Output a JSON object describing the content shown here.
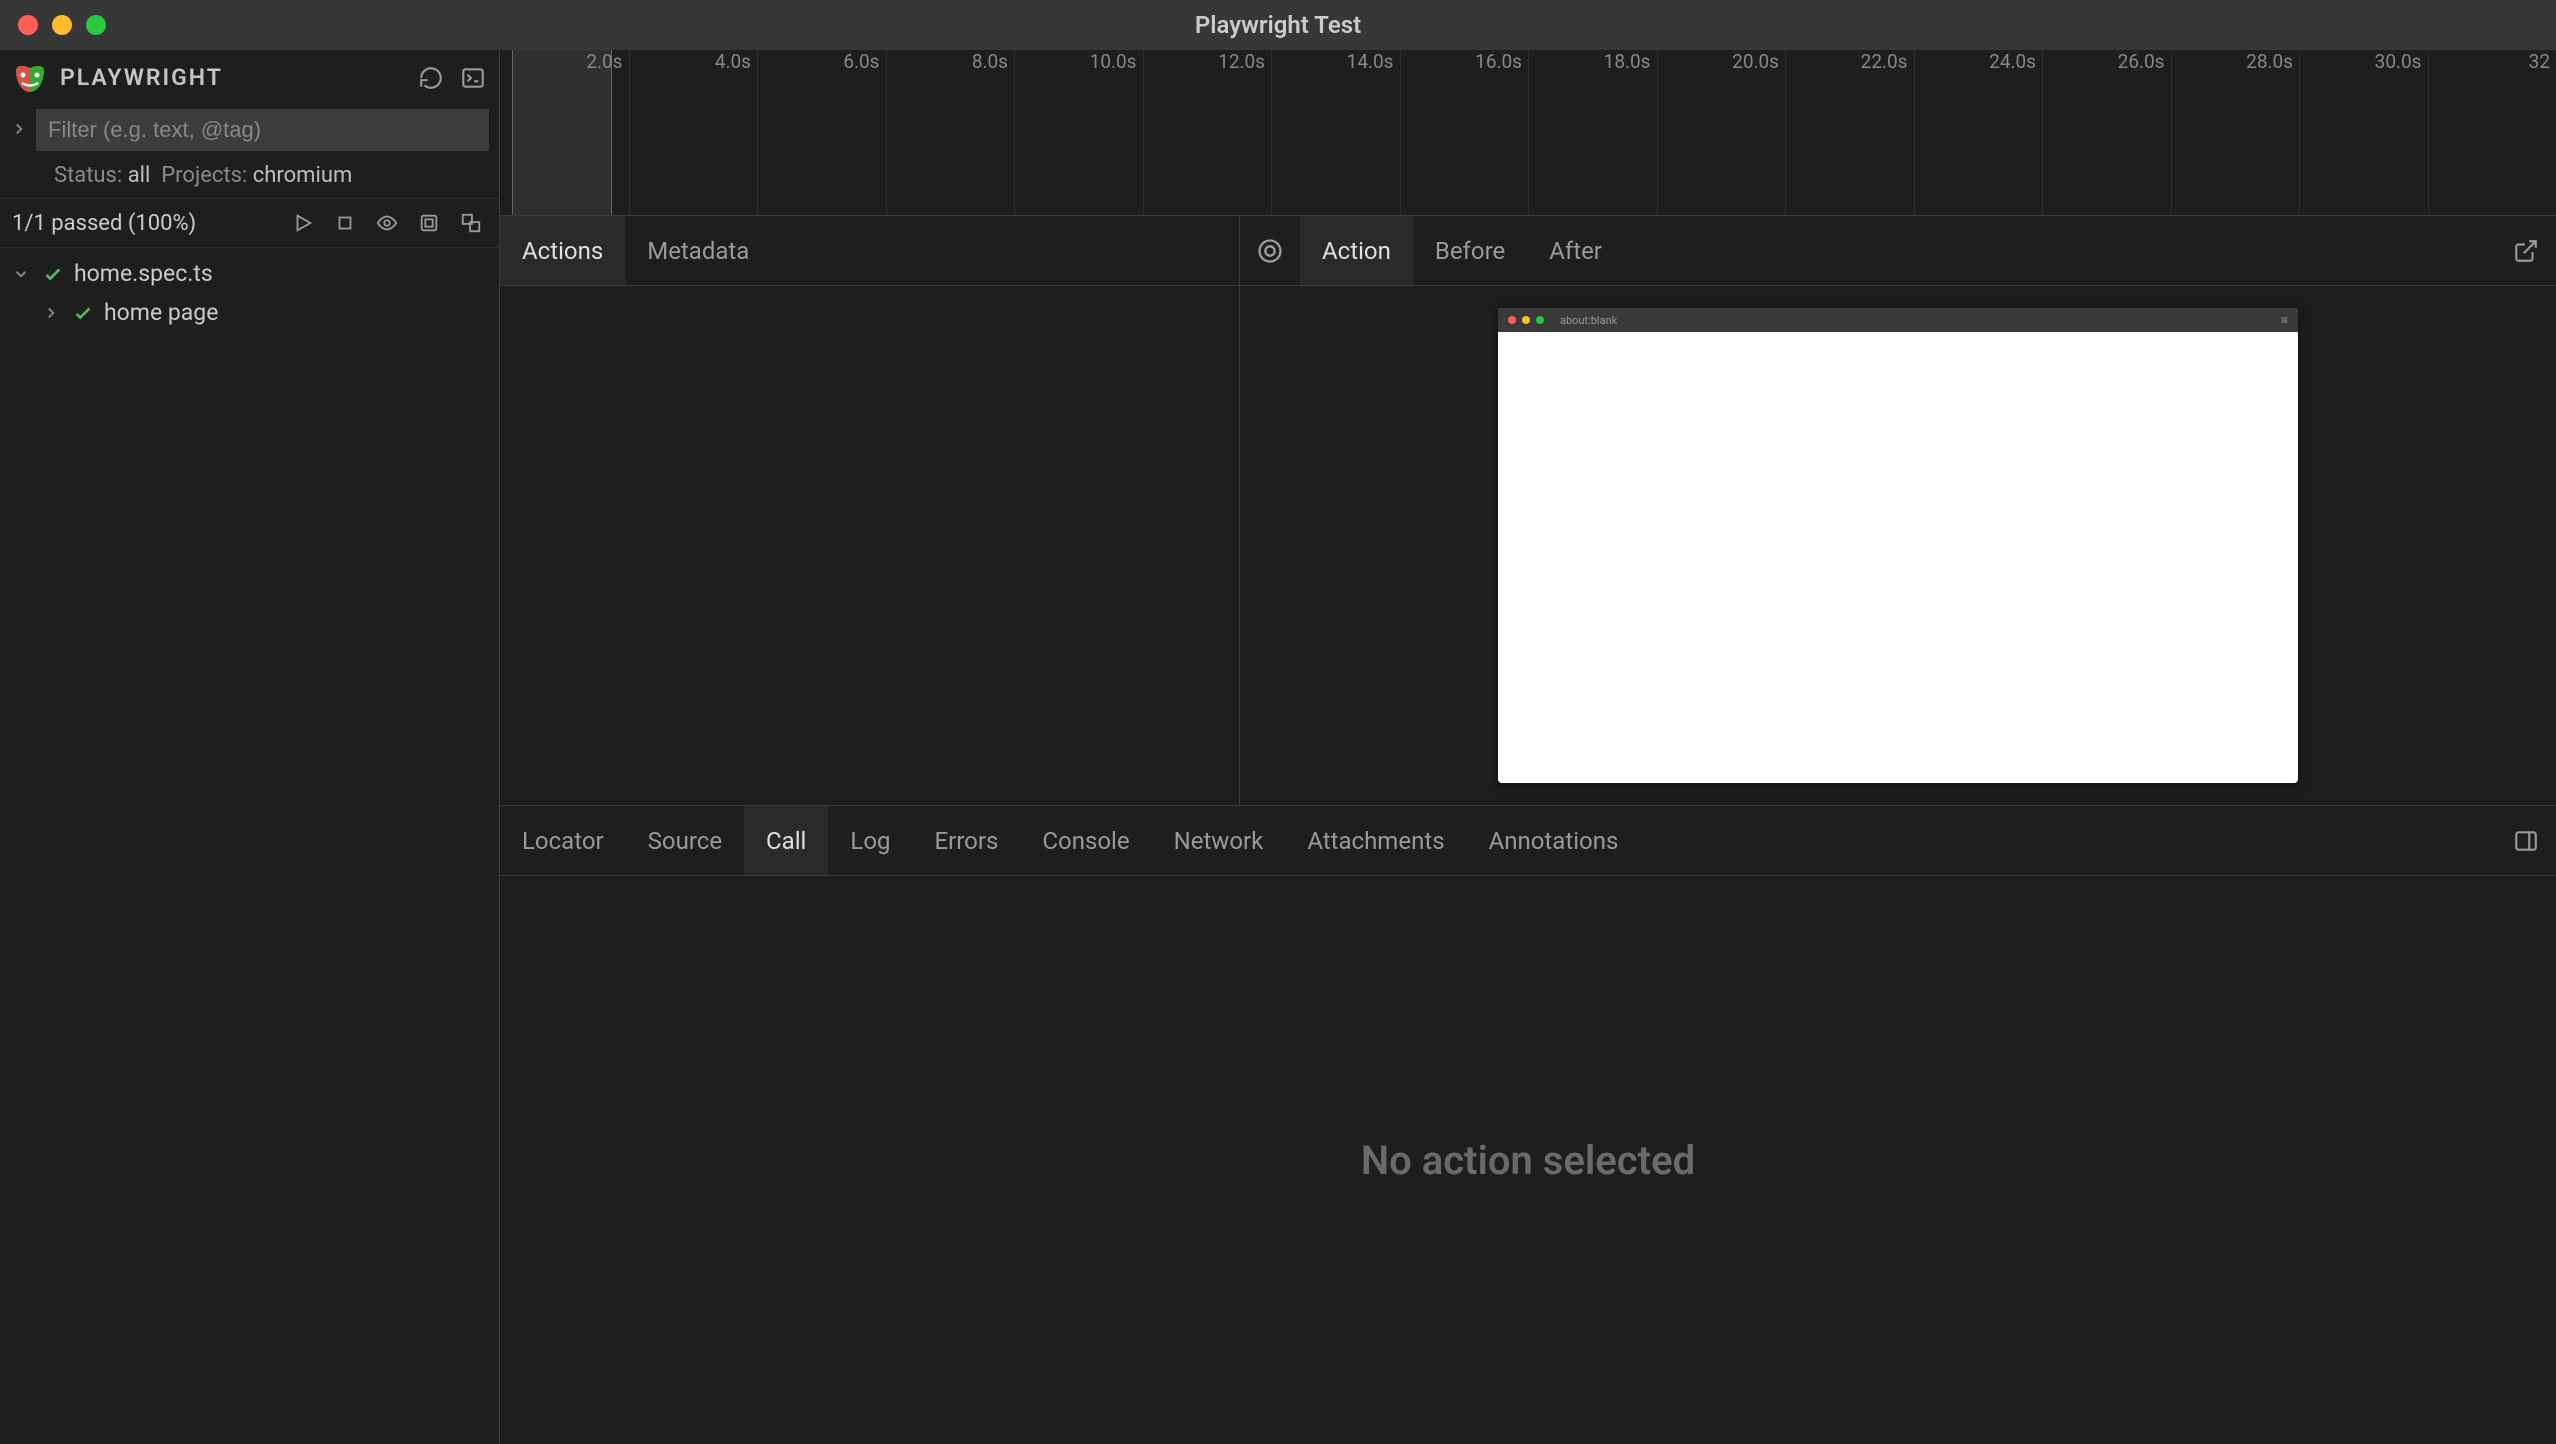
{
  "window": {
    "title": "Playwright Test"
  },
  "sidebar": {
    "brand": "PLAYWRIGHT",
    "filter_placeholder": "Filter (e.g. text, @tag)",
    "status_label": "Status:",
    "status_value": "all",
    "projects_label": "Projects:",
    "projects_value": "chromium",
    "pass_summary": "1/1 passed (100%)",
    "tree": [
      {
        "label": "home.spec.ts",
        "expanded": true,
        "status": "passed"
      },
      {
        "label": "home page",
        "is_child": true,
        "status": "passed"
      }
    ]
  },
  "timeline": {
    "ticks": [
      "2.0s",
      "4.0s",
      "6.0s",
      "8.0s",
      "10.0s",
      "12.0s",
      "14.0s",
      "16.0s",
      "18.0s",
      "20.0s",
      "22.0s",
      "24.0s",
      "26.0s",
      "28.0s",
      "30.0s",
      "32"
    ]
  },
  "actions_tabs": {
    "actions": "Actions",
    "metadata": "Metadata"
  },
  "preview_tabs": {
    "action": "Action",
    "before": "Before",
    "after": "After"
  },
  "preview": {
    "url": "about:blank"
  },
  "bottom_tabs": {
    "locator": "Locator",
    "source": "Source",
    "call": "Call",
    "log": "Log",
    "errors": "Errors",
    "console": "Console",
    "network": "Network",
    "attachments": "Attachments",
    "annotations": "Annotations"
  },
  "bottom_body": {
    "no_action": "No action selected"
  }
}
